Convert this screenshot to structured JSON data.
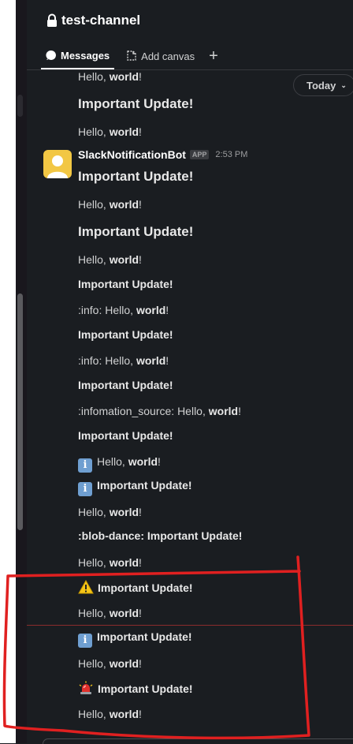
{
  "header": {
    "channel_name": "test-channel",
    "tabs": [
      {
        "label": "Messages",
        "active": true
      },
      {
        "label": "Add canvas",
        "active": false
      }
    ],
    "add_tab": "+"
  },
  "date_pill": {
    "label": "Today"
  },
  "sender": {
    "name": "SlackNotificationBot",
    "badge": "APP",
    "time": "2:53 PM",
    "avatar_color": "#f2c744"
  },
  "messages": {
    "m0": "Hello, world!",
    "m1": "Important Update!",
    "m2": "Hello, world!",
    "m3": "Important Update!",
    "m4": "Hello, world!",
    "m5": "Important Update!",
    "m6": "Hello, world!",
    "m7": "Important Update!",
    "m8": ":info: Hello, world!",
    "m9": "Important Update!",
    "m10": ":info: Hello, world!",
    "m11": "Important Update!",
    "m12": ":infomation_source: Hello, world!",
    "m13": "Important Update!",
    "m14": "Hello, world!",
    "m15": "Important Update!",
    "m16": "Hello, world!",
    "m17": ":blob-dance: Important Update!",
    "m18": "Hello, world!",
    "m19": "Important Update!",
    "m20": "Hello, world!",
    "m21": "Important Update!",
    "m22": "Hello, world!",
    "m23": "Important Update!",
    "m24": "Hello, world!"
  },
  "icons": {
    "lock": "lock-icon",
    "messages": "message-bubble-icon",
    "canvas": "canvas-icon",
    "info": "information-source-icon",
    "warning": "warning-icon",
    "siren": "rotating-light-icon"
  },
  "colors": {
    "background": "#1a1d21",
    "annotation": "#e02020"
  }
}
